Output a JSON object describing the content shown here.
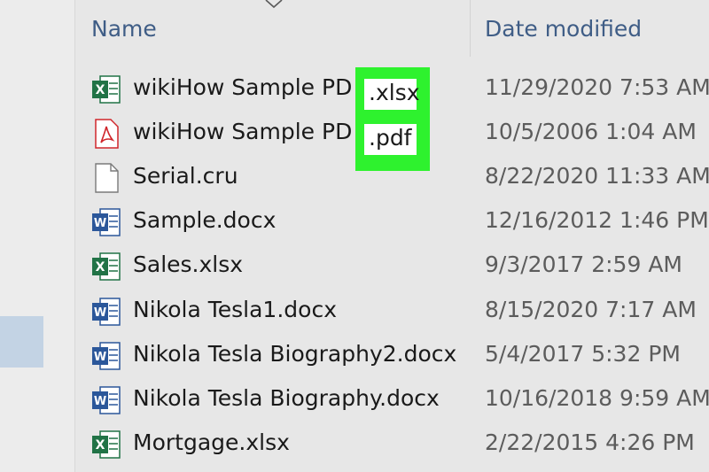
{
  "columns": {
    "name": "Name",
    "date_modified": "Date modified"
  },
  "files": [
    {
      "name": "wikiHow Sample PD",
      "date": "11/29/2020 7:53 AM",
      "icon": "excel-file-icon"
    },
    {
      "name": "wikiHow Sample PD",
      "date": "10/5/2006 1:04 AM",
      "icon": "pdf-file-icon"
    },
    {
      "name": "Serial.cru",
      "date": "8/22/2020 11:33 AM",
      "icon": "generic-file-icon"
    },
    {
      "name": "Sample.docx",
      "date": "12/16/2012 1:46 PM",
      "icon": "word-file-icon"
    },
    {
      "name": "Sales.xlsx",
      "date": "9/3/2017 2:59 AM",
      "icon": "excel-file-icon"
    },
    {
      "name": "Nikola Tesla1.docx",
      "date": "8/15/2020 7:17 AM",
      "icon": "word-file-icon"
    },
    {
      "name": "Nikola Tesla Biography2.docx",
      "date": "5/4/2017 5:32 PM",
      "icon": "word-file-icon"
    },
    {
      "name": "Nikola Tesla Biography.docx",
      "date": "10/16/2018 9:59 AM",
      "icon": "word-file-icon"
    },
    {
      "name": "Mortgage.xlsx",
      "date": "2/22/2015 4:26 PM",
      "icon": "excel-file-icon"
    }
  ],
  "highlighted_extensions": [
    ".xlsx",
    ".pdf"
  ],
  "colors": {
    "highlight": "#2ef22e",
    "header_text": "#3f5d86",
    "excel": "#217346",
    "word": "#2b579a",
    "pdf": "#d0262b"
  }
}
